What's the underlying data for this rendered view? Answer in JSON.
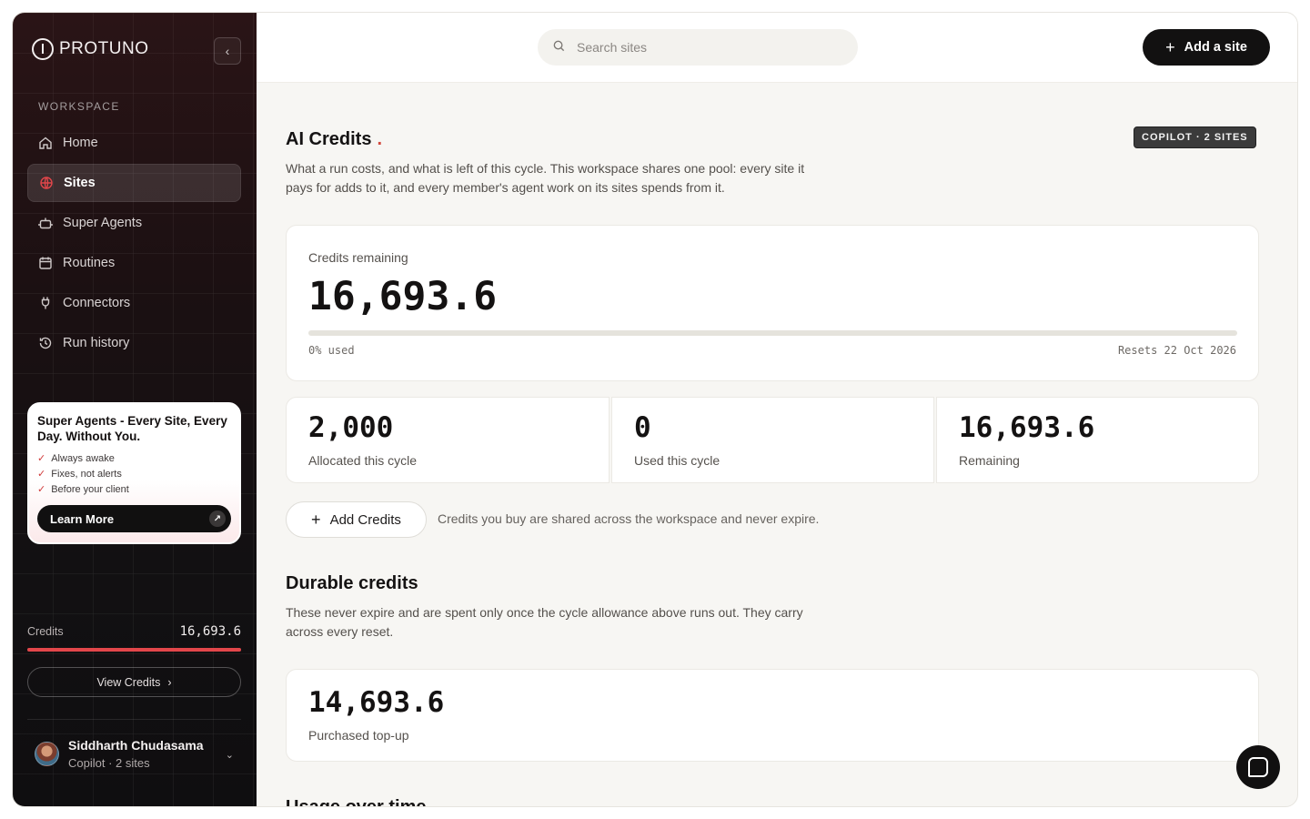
{
  "brand": {
    "name": "PROTUNO"
  },
  "sidebar": {
    "section_label": "WORKSPACE",
    "items": [
      {
        "label": "Home",
        "icon": "home-icon"
      },
      {
        "label": "Sites",
        "icon": "globe-icon",
        "active": true
      },
      {
        "label": "Super Agents",
        "icon": "robot-icon"
      },
      {
        "label": "Routines",
        "icon": "calendar-icon"
      },
      {
        "label": "Connectors",
        "icon": "plug-icon"
      },
      {
        "label": "Run history",
        "icon": "history-icon"
      }
    ],
    "promo": {
      "title": "Super Agents - Every Site, Every Day. Without You.",
      "bullets": [
        "Always awake",
        "Fixes, not alerts",
        "Before your client"
      ],
      "cta": "Learn More"
    },
    "credits": {
      "label": "Credits",
      "value": "16,693.6",
      "used_fraction": 1.0
    },
    "view_credits": "View Credits",
    "user": {
      "name": "Siddharth Chudasama",
      "subtitle": "Copilot · 2 sites"
    }
  },
  "topbar": {
    "search_placeholder": "Search sites",
    "add_site": "Add a site"
  },
  "ai_credits": {
    "title": "AI Credits",
    "badge": "COPILOT · 2 SITES",
    "description": "What a run costs, and what is left of this cycle. This workspace shares one pool: every site it pays for adds to it, and every member's agent work on its sites spends from it.",
    "remaining_label": "Credits remaining",
    "remaining_value": "16,693.6",
    "used_percent_text": "0% used",
    "used_percent": 0,
    "resets": "Resets 22 Oct 2026",
    "stats": [
      {
        "value": "2,000",
        "label": "Allocated this cycle"
      },
      {
        "value": "0",
        "label": "Used this cycle"
      },
      {
        "value": "16,693.6",
        "label": "Remaining"
      }
    ],
    "add_credits": "Add Credits",
    "add_note": "Credits you buy are shared across the workspace and never expire."
  },
  "durable": {
    "title": "Durable credits",
    "description": "These never expire and are spent only once the cycle allowance above runs out. They carry across every reset.",
    "value": "14,693.6",
    "label": "Purchased top-up"
  },
  "usage": {
    "title": "Usage over time"
  },
  "colors": {
    "accent": "#d2483d",
    "credit_bar": "#e2464a",
    "dark": "#121111"
  }
}
